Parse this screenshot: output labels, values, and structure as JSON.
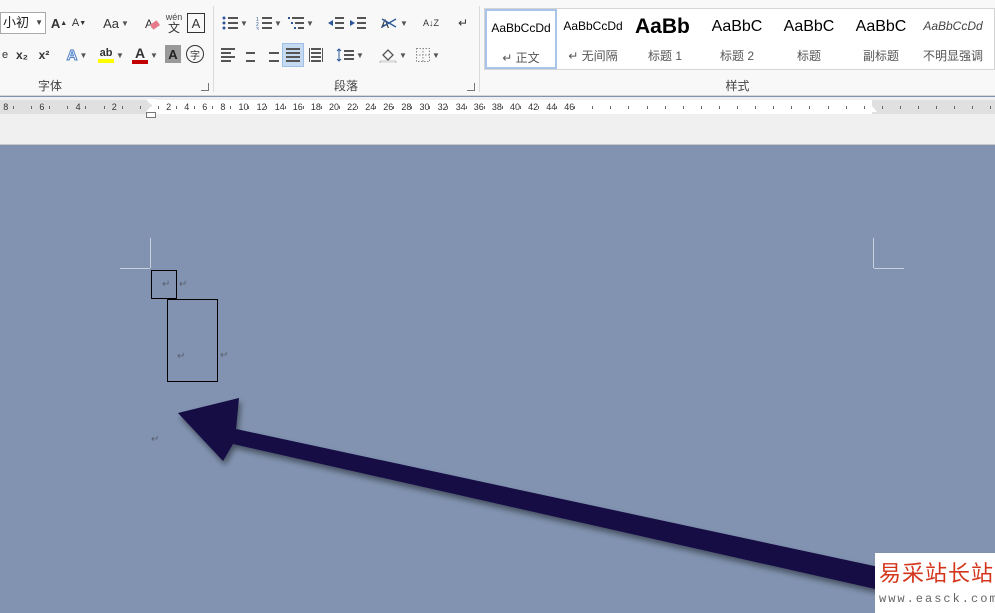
{
  "ribbon": {
    "font_group": {
      "label": "字体",
      "font_size": "小初",
      "grow_font": "A",
      "shrink_font": "A",
      "change_case": "Aa",
      "phonetic_top": "wén",
      "phonetic_bottom": "文",
      "char_border": "A",
      "subscript": "x₂",
      "superscript": "x²",
      "text_effect": "A",
      "highlight": "ab",
      "font_color": "A",
      "char_shading": "A",
      "enclose": "字"
    },
    "paragraph_group": {
      "label": "段落",
      "sort": "A↓Z"
    },
    "styles_group": {
      "label": "样式",
      "items": [
        {
          "sample": "AaBbCcDd",
          "name": "↵ 正文"
        },
        {
          "sample": "AaBbCcDd",
          "name": "↵ 无间隔"
        },
        {
          "sample": "AaBb",
          "name": "标题 1"
        },
        {
          "sample": "AaBbC",
          "name": "标题 2"
        },
        {
          "sample": "AaBbC",
          "name": "标题"
        },
        {
          "sample": "AaBbC",
          "name": "副标题"
        },
        {
          "sample": "AaBbCcDd",
          "name": "不明显强调"
        }
      ]
    },
    "colors": {
      "highlight": "#ffff00",
      "font_color": "#c00000",
      "accent": "#2b579a"
    }
  },
  "ruler": {
    "left_numbers": [
      "8",
      "6",
      "4",
      "2"
    ],
    "right_numbers": [
      "2",
      "4",
      "6",
      "8",
      "10",
      "12",
      "14",
      "16",
      "18",
      "20",
      "22",
      "24",
      "26",
      "28",
      "30",
      "32",
      "34",
      "36",
      "38",
      "40",
      "42",
      "44",
      "46"
    ]
  },
  "document": {
    "paragraph_mark": "↵"
  },
  "watermark": {
    "chinese": "易采站长站",
    "url": "www.easck.com"
  }
}
